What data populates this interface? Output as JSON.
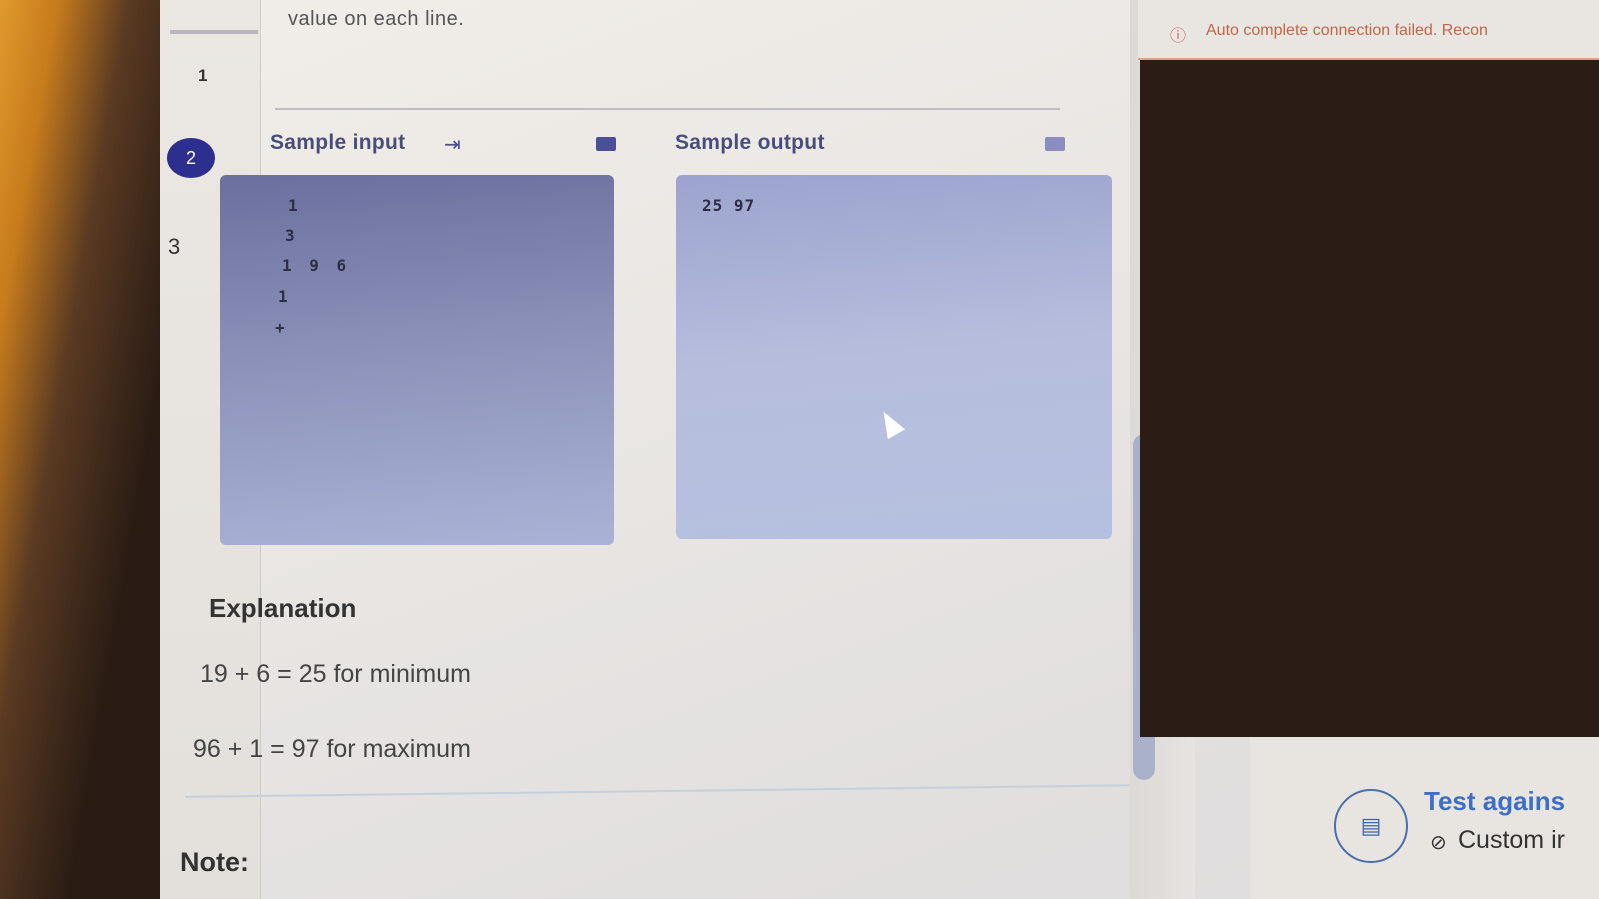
{
  "problem": {
    "description_tail": "value on each line.",
    "steps": [
      "1",
      "2",
      "3"
    ],
    "sample_input": {
      "label": "Sample input",
      "lines": [
        "1",
        "3",
        "1 9 6",
        "1",
        "+"
      ]
    },
    "sample_output": {
      "label": "Sample output",
      "lines": [
        "25 97"
      ]
    },
    "explanation": {
      "heading": "Explanation",
      "lines": [
        "19 + 6 = 25 for minimum",
        "96 + 1 = 97 for maximum"
      ]
    },
    "note_heading": "Note:"
  },
  "editor": {
    "notice": "Auto complete connection failed. Recon"
  },
  "run_panel": {
    "test_label": "Test agains",
    "custom_label": "Custom ir"
  },
  "icons": {
    "copy": "copy-icon",
    "enter": "enter-arrow-icon",
    "split": "split-handle-icon",
    "terminal": "terminal-file-icon",
    "check": "check-circle-icon",
    "warning": "warning-icon"
  },
  "colors": {
    "accent": "#2c2f8e",
    "link": "#3e6fc6",
    "notice": "#c0674a"
  }
}
